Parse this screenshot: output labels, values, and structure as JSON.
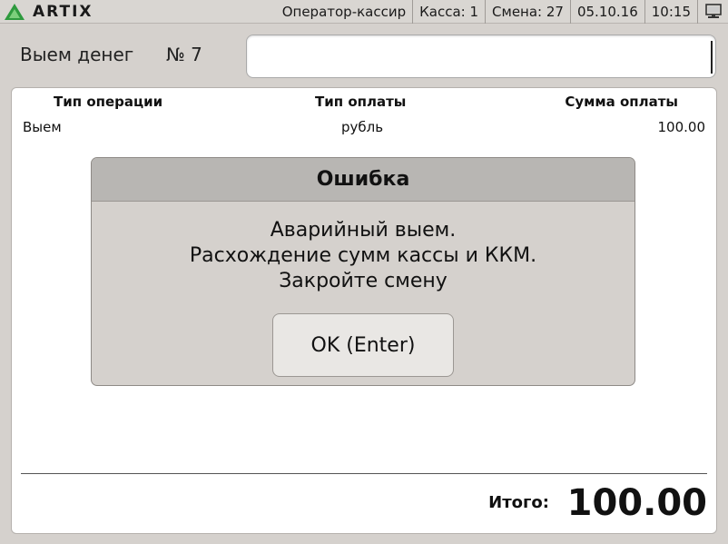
{
  "app": {
    "logo_text": "ARTIX",
    "accent_color": "#2e9a3e"
  },
  "status_bar": {
    "user": "Оператор-кассир",
    "register": "Касса: 1",
    "shift": "Смена: 27",
    "date": "05.10.16",
    "time": "10:15",
    "network_icon": "network-computer-icon"
  },
  "document": {
    "title": "Выем денег",
    "number": "№ 7",
    "input_value": ""
  },
  "table": {
    "columns": [
      "Тип операции",
      "Тип оплаты",
      "Сумма оплаты"
    ],
    "rows": [
      {
        "operation": "Выем",
        "payment": "рубль",
        "amount": "100.00"
      }
    ]
  },
  "totals": {
    "label": "Итого:",
    "value": "100.00"
  },
  "dialog": {
    "title": "Ошибка",
    "lines": [
      "Аварийный выем.",
      "Расхождение сумм кассы и ККМ.",
      "Закройте смену"
    ],
    "ok_label": "OK (Enter)"
  }
}
